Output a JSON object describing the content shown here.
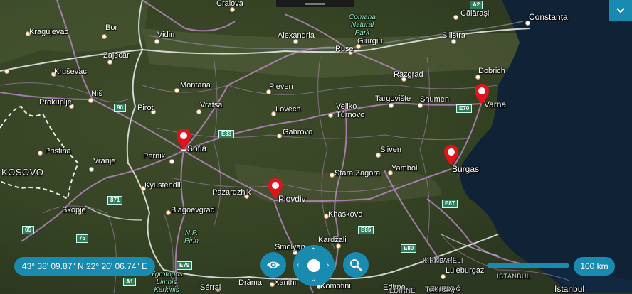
{
  "map": {
    "cities": [
      {
        "name": "Craiova"
      },
      {
        "name": "Călăraşi"
      },
      {
        "name": "Constanţa"
      },
      {
        "name": "Kragujevac"
      },
      {
        "name": "Bor"
      },
      {
        "name": "Vidin"
      },
      {
        "name": "Alexandria"
      },
      {
        "name": "Silistra"
      },
      {
        "name": "Giurgiu"
      },
      {
        "name": "Ruse"
      },
      {
        "name": "Zaječar"
      },
      {
        "name": "Razgrad"
      },
      {
        "name": "Dobrich"
      },
      {
        "name": "Kruševac"
      },
      {
        "name": "Montana"
      },
      {
        "name": "Pleven"
      },
      {
        "name": "Targovište"
      },
      {
        "name": "Shumen"
      },
      {
        "name": "Niš"
      },
      {
        "name": "Prokuplje"
      },
      {
        "name": "Pirot"
      },
      {
        "name": "Vratsa"
      },
      {
        "name": "Lovech"
      },
      {
        "name": "Veliko Tŭrnovo"
      },
      {
        "name": "Varna"
      },
      {
        "name": "Gabrovo"
      },
      {
        "name": "Sofia"
      },
      {
        "name": "Pristina"
      },
      {
        "name": "Pernik"
      },
      {
        "name": "Sliven"
      },
      {
        "name": "Vranje"
      },
      {
        "name": "Burgas"
      },
      {
        "name": "Yambol"
      },
      {
        "name": "Stara Zagora"
      },
      {
        "name": "Kyustendil"
      },
      {
        "name": "Pazardzhik"
      },
      {
        "name": "Plovdiv"
      },
      {
        "name": "Skopje"
      },
      {
        "name": "Blagoevgrad"
      },
      {
        "name": "Khaskovo"
      },
      {
        "name": "Kardžali"
      },
      {
        "name": "Smolyan"
      },
      {
        "name": "Kirklareli"
      },
      {
        "name": "Lüleburgaz"
      },
      {
        "name": "Drâma"
      },
      {
        "name": "Xánthi"
      },
      {
        "name": "Komotini"
      },
      {
        "name": "Sérrai"
      },
      {
        "name": "Edirne"
      },
      {
        "name": "Istanbul"
      },
      {
        "name": "Tekirdağ"
      }
    ],
    "country_labels": [
      {
        "name": "KOSOVO"
      }
    ],
    "park_labels": [
      {
        "name": "Comana Natural Park"
      },
      {
        "name": "N.P. Pirin"
      },
      {
        "name": "Ygrotopos Limnis Kerkinis"
      }
    ],
    "region_labels": [
      {
        "name": "KIRKLARELI"
      },
      {
        "name": "ISTANBUL"
      },
      {
        "name": "TEKIRDAĞ"
      },
      {
        "name": "EDIRNE"
      }
    ],
    "road_shields": [
      {
        "name": "A2"
      },
      {
        "name": "80"
      },
      {
        "name": "E70"
      },
      {
        "name": "E83"
      },
      {
        "name": "871"
      },
      {
        "name": "65"
      },
      {
        "name": "75"
      },
      {
        "name": "E79"
      },
      {
        "name": "A1"
      },
      {
        "name": "E85"
      },
      {
        "name": "E80"
      },
      {
        "name": "E87"
      }
    ],
    "pins": [
      {
        "name": "Sofia"
      },
      {
        "name": "Plovdiv"
      },
      {
        "name": "Varna"
      },
      {
        "name": "Burgas"
      }
    ],
    "colors": {
      "land": "#3d4a2c",
      "sea": "#0f2236",
      "border": "#ffffff",
      "road": "#c88fd6",
      "accent": "#1a8bb0",
      "pin": "#e3121b"
    }
  },
  "controls": {
    "coordinates": "43° 38' 09.87\" N 22° 20' 06.74\" E",
    "scale": "100 km",
    "collapse_icon": "chevron-down-icon",
    "view_icon": "eye-icon",
    "search_icon": "search-icon",
    "pan_icon": "pan-arrows-icon"
  }
}
